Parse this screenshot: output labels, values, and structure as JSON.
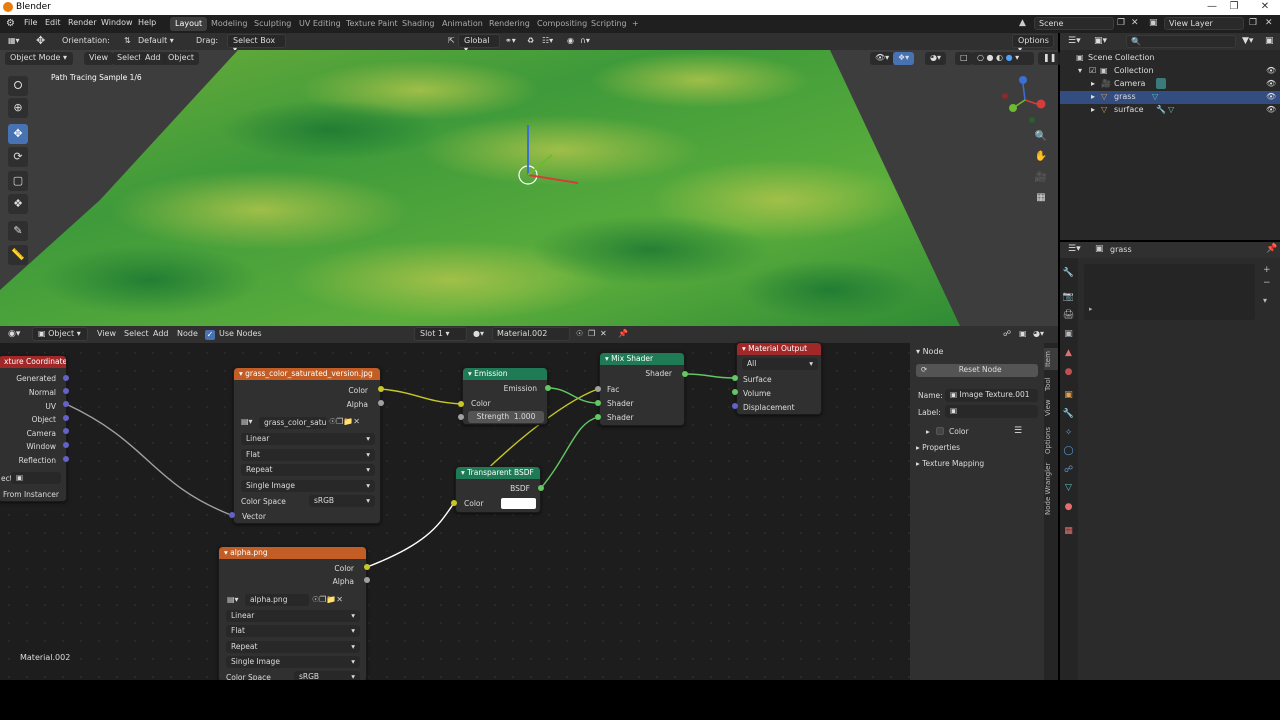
{
  "window": {
    "title": "Blender"
  },
  "menubar": {
    "menus": [
      "File",
      "Edit",
      "Render",
      "Window",
      "Help"
    ],
    "workspaces": [
      "Layout",
      "Modeling",
      "Sculpting",
      "UV Editing",
      "Texture Paint",
      "Shading",
      "Animation",
      "Rendering",
      "Compositing",
      "Scripting"
    ],
    "active_workspace": "Layout",
    "add_tab": "+",
    "scene": "Scene",
    "view_layer": "View Layer"
  },
  "toolbar": {
    "orientation_label": "Orientation:",
    "orientation_value": "Default",
    "drag_label": "Drag:",
    "drag_value": "Select Box",
    "transform_orientation": "Global",
    "options": "Options"
  },
  "viewport": {
    "mode": "Object Mode",
    "menus": [
      "View",
      "Select",
      "Add",
      "Object"
    ],
    "status": "Path Tracing Sample 1/6",
    "accent": "#4772b3"
  },
  "outliner": {
    "items": [
      {
        "label": "Scene Collection",
        "icon": "scene-collection-icon"
      },
      {
        "label": "Collection",
        "icon": "collection-icon"
      },
      {
        "label": "Camera",
        "icon": "camera-icon"
      },
      {
        "label": "grass",
        "icon": "mesh-icon",
        "selected": true
      },
      {
        "label": "surface",
        "icon": "mesh-icon"
      }
    ]
  },
  "properties": {
    "object_name": "grass"
  },
  "node_editor": {
    "editor_type": "Object",
    "menus": [
      "View",
      "Select",
      "Add",
      "Node"
    ],
    "use_nodes": "Use Nodes",
    "slot": "Slot 1",
    "material": "Material.002",
    "footer_material": "Material.002"
  },
  "nodes": {
    "texcoord": {
      "title": "xture Coordinate",
      "outputs": [
        "Generated",
        "Normal",
        "UV",
        "Object",
        "Camera",
        "Window",
        "Reflection"
      ],
      "object_field_prefix": "ect",
      "from_instancer": "From Instancer"
    },
    "grass_tex": {
      "title": "grass_color_saturated_version.jpg",
      "out_color": "Color",
      "out_alpha": "Alpha",
      "image": "grass_color_satu...",
      "interpolation": "Linear",
      "projection": "Flat",
      "extension": "Repeat",
      "source": "Single Image",
      "colorspace_label": "Color Space",
      "colorspace": "sRGB",
      "vector": "Vector"
    },
    "alpha_tex": {
      "title": "alpha.png",
      "out_color": "Color",
      "out_alpha": "Alpha",
      "image": "alpha.png",
      "interpolation": "Linear",
      "projection": "Flat",
      "extension": "Repeat",
      "source": "Single Image",
      "colorspace_label": "Color Space",
      "colorspace": "sRGB"
    },
    "emission": {
      "title": "Emission",
      "out": "Emission",
      "in_color": "Color",
      "strength_label": "Strength",
      "strength": "1.000"
    },
    "transparent": {
      "title": "Transparent BSDF",
      "out": "BSDF",
      "in_color": "Color"
    },
    "mix": {
      "title": "Mix Shader",
      "out": "Shader",
      "in_fac": "Fac",
      "in_shader1": "Shader",
      "in_shader2": "Shader"
    },
    "output": {
      "title": "Material Output",
      "target": "All",
      "in_surface": "Surface",
      "in_volume": "Volume",
      "in_displacement": "Displacement"
    }
  },
  "npanel": {
    "section": "Node",
    "reset": "Reset Node",
    "name_label": "Name:",
    "name_value": "Image Texture.001",
    "label_label": "Label:",
    "label_value": "",
    "color": "Color",
    "properties": "Properties",
    "texture_mapping": "Texture Mapping",
    "tabs": [
      "Item",
      "Tool",
      "View",
      "Options",
      "Node Wrangler"
    ]
  }
}
